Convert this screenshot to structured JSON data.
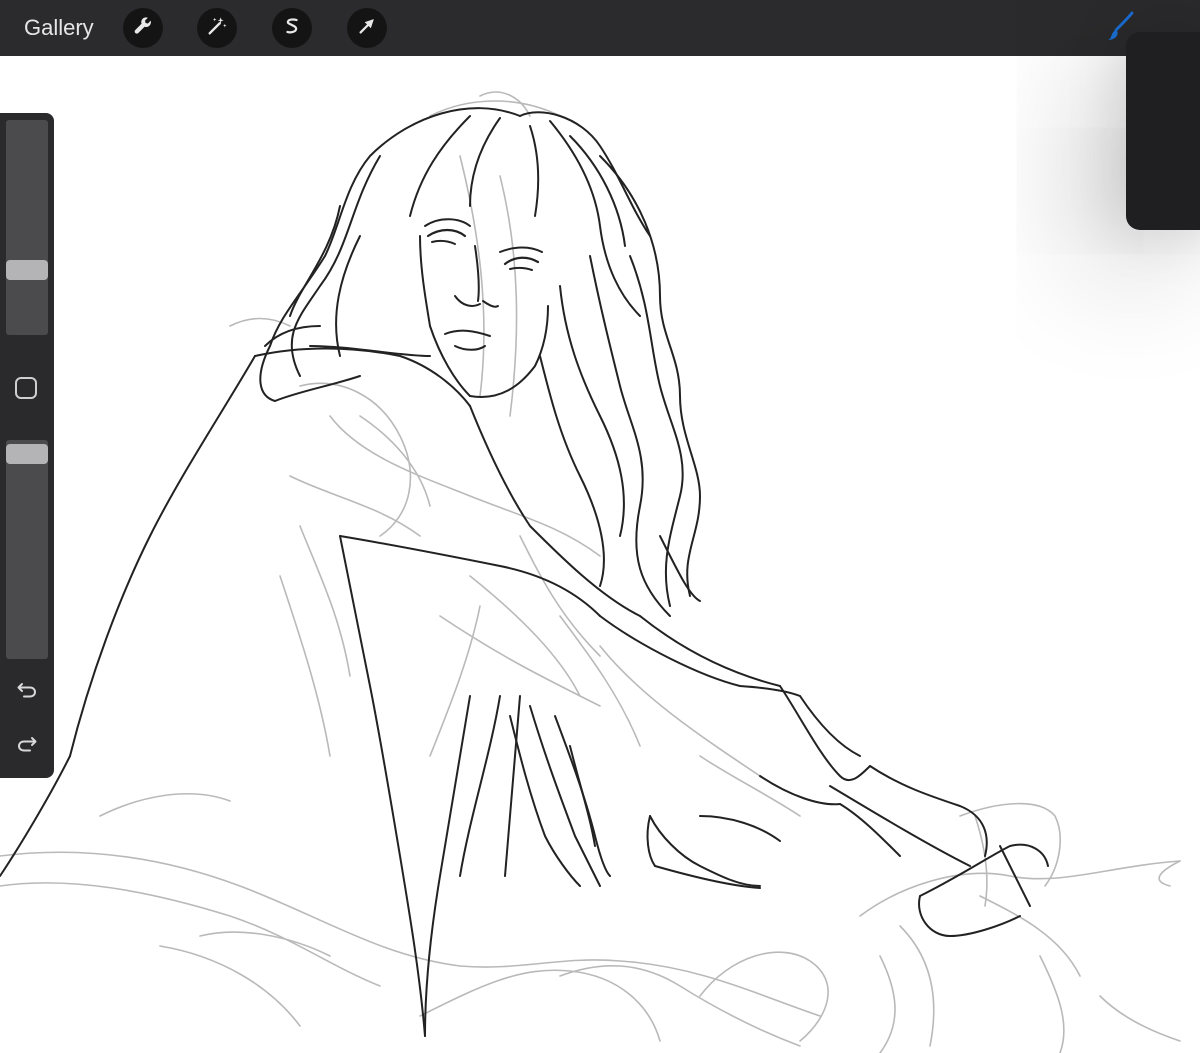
{
  "toolbar": {
    "gallery_label": "Gallery",
    "tools": [
      {
        "name": "actions",
        "icon": "wrench-icon"
      },
      {
        "name": "adjustments",
        "icon": "magic-wand-icon"
      },
      {
        "name": "selection",
        "icon": "selection-s-icon"
      },
      {
        "name": "transform",
        "icon": "arrow-cursor-icon"
      }
    ],
    "active_tool": {
      "name": "brush",
      "icon": "brush-icon",
      "color": "#1a6fd6"
    }
  },
  "sidebar": {
    "brush_size_level": 0.28,
    "opacity_level": 0.02,
    "modify_icon": "square-icon",
    "undo_icon": "undo-icon",
    "redo_icon": "redo-icon"
  },
  "colors": {
    "toolbar_bg": "#2b2b2d",
    "sidebar_bg": "#2a2a2c",
    "accent": "#1a6fd6",
    "canvas_bg": "#ffffff"
  }
}
